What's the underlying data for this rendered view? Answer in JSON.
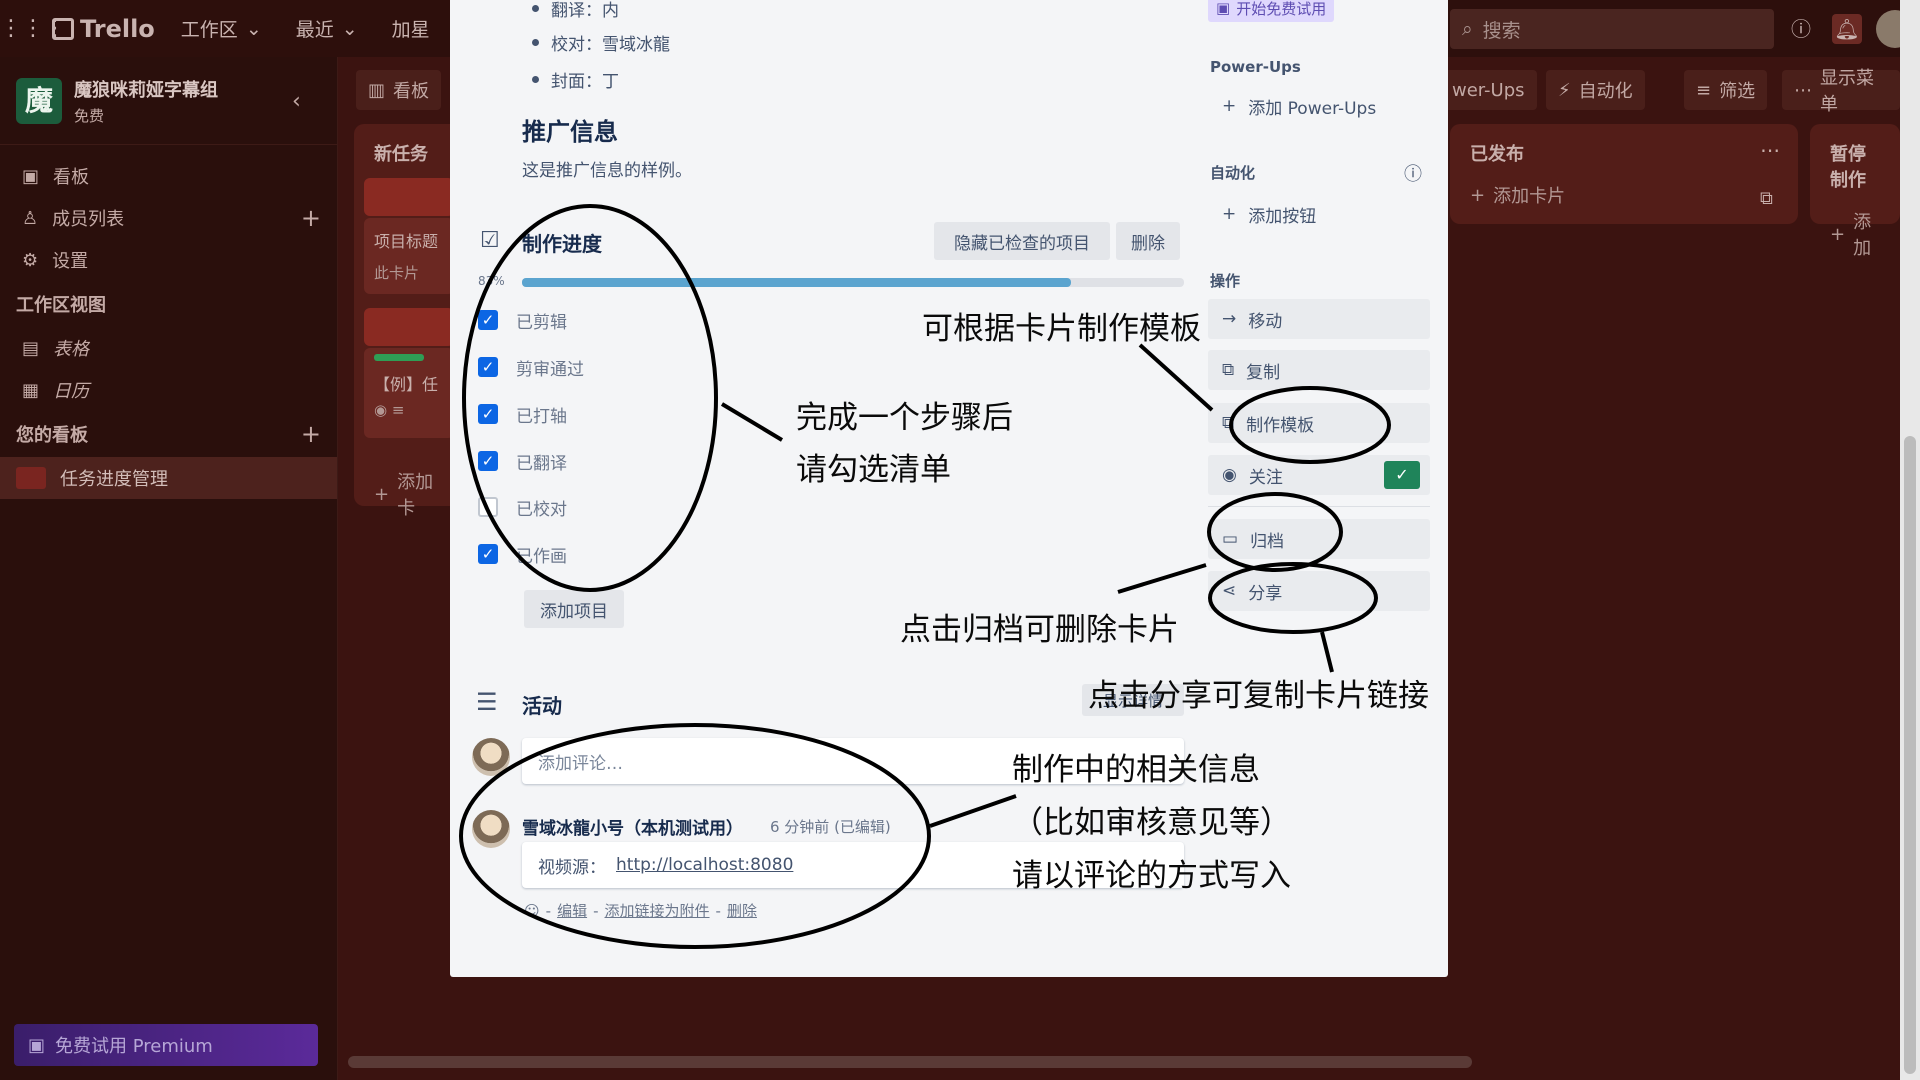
{
  "topbar": {
    "app_name": "Trello",
    "menus": [
      "工作区",
      "最近",
      "加星"
    ],
    "search_placeholder": "搜索"
  },
  "sidebar": {
    "workspace_initial": "魔",
    "workspace_name": "魔狼咪莉娅字幕组",
    "workspace_plan": "免费",
    "items": [
      {
        "label": "看板"
      },
      {
        "label": "成员列表"
      },
      {
        "label": "设置"
      }
    ],
    "views_header": "工作区视图",
    "views": [
      {
        "label": "表格"
      },
      {
        "label": "日历"
      }
    ],
    "boards_header": "您的看板",
    "current_board": "任务进度管理",
    "premium_label": "免费试用 Premium"
  },
  "board": {
    "view_button": "看板",
    "powerups_button": "wer-Ups",
    "automation_button": "自动化",
    "filter_button": "筛选",
    "menu_button": "显示菜单",
    "lists": [
      {
        "title": "新任务",
        "add_label": "添加卡"
      },
      {
        "title": "已发布",
        "add_label": "添加卡片"
      },
      {
        "title": "暂停制作",
        "add_label": "添加"
      }
    ],
    "card_snippets": [
      "项目标题",
      "此卡片",
      "【例】任"
    ]
  },
  "modal": {
    "bullets": [
      {
        "text": "翻译：内"
      },
      {
        "text": "校对：雪域冰龍"
      },
      {
        "text": "封面：丁"
      }
    ],
    "promo_title": "推广信息",
    "promo_text": "这是推广信息的样例。",
    "checklist": {
      "title": "制作进度",
      "hide_button": "隐藏已检查的项目",
      "delete_button": "删除",
      "progress_label": "83%",
      "progress": 0.83,
      "items": [
        {
          "label": "已剪辑",
          "checked": true
        },
        {
          "label": "剪审通过",
          "checked": true
        },
        {
          "label": "已打轴",
          "checked": true
        },
        {
          "label": "已翻译",
          "checked": true
        },
        {
          "label": "已校对",
          "checked": false
        },
        {
          "label": "已作画",
          "checked": true
        }
      ],
      "add_item": "添加项目"
    },
    "activity": {
      "title": "活动",
      "details_button": "显示详情",
      "comment_placeholder": "添加评论…",
      "comment_author": "雪域冰龍小号（本机测试用）",
      "comment_time": "6 分钟前 (已编辑)",
      "comment_prefix": "视频源：",
      "comment_link": "http://localhost:8080",
      "comment_actions": [
        "编辑",
        "添加链接为附件",
        "删除"
      ]
    },
    "sidebar": {
      "trial_button": "开始免费试用",
      "powerups_header": "Power-Ups",
      "add_powerups": "添加 Power-Ups",
      "automation_header": "自动化",
      "add_button": "添加按钮",
      "actions_header": "操作",
      "actions": [
        "移动",
        "复制",
        "制作模板",
        "关注",
        "归档",
        "分享"
      ]
    }
  },
  "annotations": {
    "template": "可根据卡片制作模板",
    "check_line1": "完成一个步骤后",
    "check_line2": "请勾选清单",
    "archive": "点击归档可删除卡片",
    "share": "点击分享可复制卡片链接",
    "comment_line1": "制作中的相关信息",
    "comment_line2": "（比如审核意见等）",
    "comment_line3": "请以评论的方式写入"
  },
  "colors": {
    "board_bg": "#3b1310",
    "accent": "#0c66e4",
    "progress": "#5ba4cf",
    "watch_check": "#1f845a"
  }
}
